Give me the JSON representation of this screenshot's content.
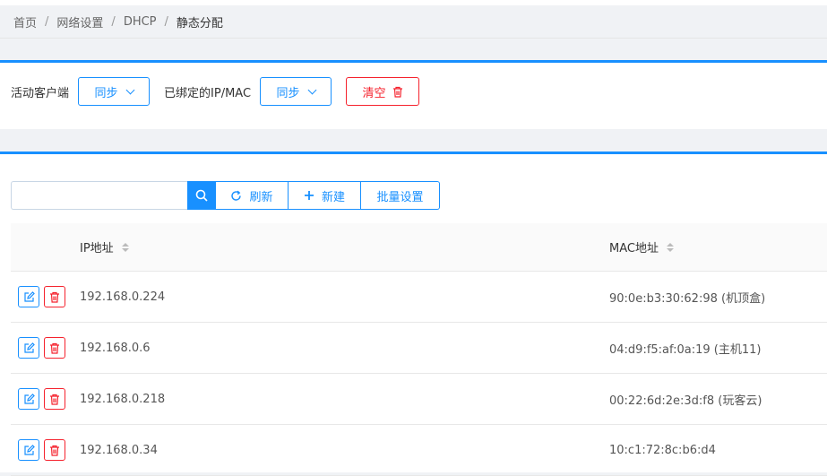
{
  "breadcrumb": {
    "home": "首页",
    "network": "网络设置",
    "dhcp": "DHCP",
    "current": "静态分配",
    "separator": "/"
  },
  "sync_panel": {
    "active_clients_label": "活动客户端",
    "active_clients_button": "同步",
    "bound_label": "已绑定的IP/MAC",
    "bound_button": "同步",
    "clear_button": "清空"
  },
  "toolbar": {
    "search_placeholder": "",
    "search_value": "",
    "refresh_label": "刷新",
    "new_label": "新建",
    "batch_label": "批量设置"
  },
  "table": {
    "columns": {
      "ip": "IP地址",
      "mac": "MAC地址"
    },
    "rows": [
      {
        "ip": "192.168.0.224",
        "mac": "90:0e:b3:30:62:98 (机顶盒)"
      },
      {
        "ip": "192.168.0.6",
        "mac": "04:d9:f5:af:0a:19 (主机11)"
      },
      {
        "ip": "192.168.0.218",
        "mac": "00:22:6d:2e:3d:f8 (玩客云)"
      },
      {
        "ip": "192.168.0.34",
        "mac": "10:c1:72:8c:b6:d4"
      }
    ]
  },
  "colors": {
    "primary": "#1890ff",
    "danger": "#f5222d"
  }
}
